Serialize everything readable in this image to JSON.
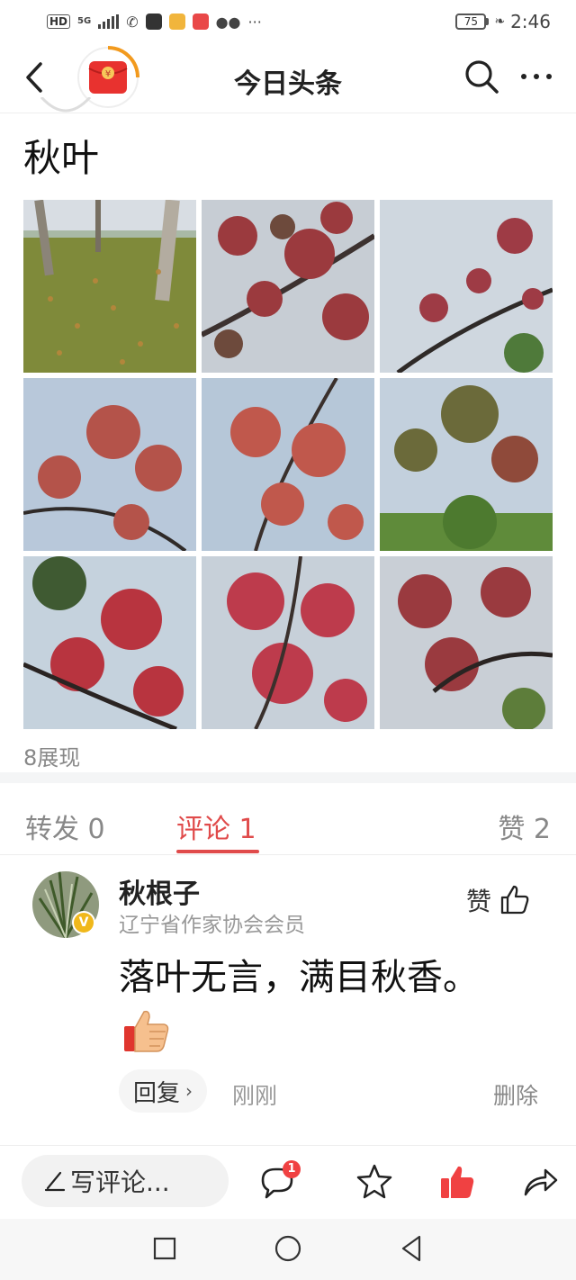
{
  "status_bar": {
    "hd": "HD",
    "network": "5G",
    "battery": "75",
    "time": "2:46"
  },
  "nav": {
    "title": "今日头条",
    "icons": [
      "back-arrow-icon",
      "red-envelope-icon",
      "search-icon",
      "more-icon"
    ]
  },
  "post": {
    "title": "秋叶",
    "views": "8展现",
    "photo_count": 9
  },
  "tabs": [
    {
      "label": "转发 0",
      "active": false
    },
    {
      "label": "评论 1",
      "active": true
    },
    {
      "label": "赞 2",
      "active": false
    }
  ],
  "comment": {
    "author": "秋根子",
    "subtitle": "辽宁省作家协会会员",
    "like_label": "赞",
    "text": "落叶无言，满目秋香。",
    "emoji": "thumbs-up-emoji",
    "reply_label": "回复",
    "time": "刚刚",
    "delete_label": "删除"
  },
  "action_bar": {
    "write_placeholder": "写评论...",
    "comment_count": "1",
    "icons": [
      "comment-icon",
      "star-icon",
      "like-icon",
      "share-icon"
    ]
  },
  "colors": {
    "accent": "#e04b4b",
    "muted": "#888888",
    "badge": "#f04142",
    "verified": "#f0b81b"
  }
}
